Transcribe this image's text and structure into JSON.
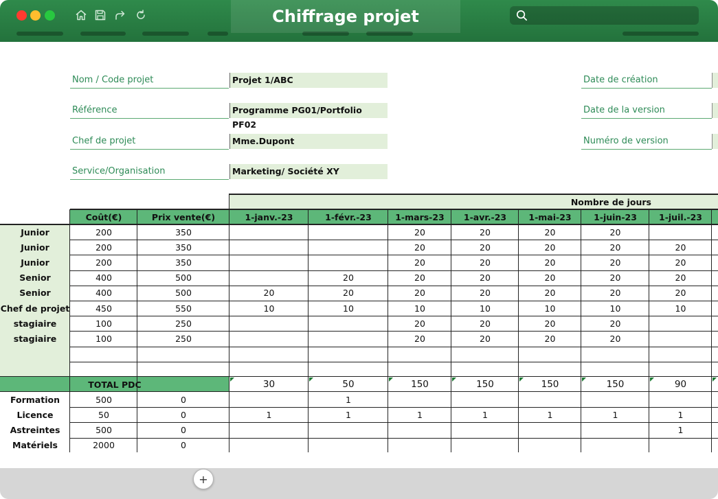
{
  "window": {
    "title": "Chiffrage projet"
  },
  "search": {
    "placeholder": ""
  },
  "project_info": {
    "left": [
      {
        "label": "Nom / Code projet",
        "value": "Projet 1/ABC"
      },
      {
        "label": "Référence",
        "value": "Programme PG01/Portfolio PF02"
      },
      {
        "label": "Chef de projet",
        "value": "Mme.Dupont"
      },
      {
        "label": "Service/Organisation",
        "value": "Marketing/ Société XY"
      }
    ],
    "right": [
      {
        "label": "Date de création",
        "value": ""
      },
      {
        "label": "Date de la version",
        "value": ""
      },
      {
        "label": "Numéro de version",
        "value": ""
      }
    ]
  },
  "table": {
    "group_header": "Nombre de jours",
    "headers": [
      "Coût(€)",
      "Prix vente(€)",
      "1-janv.-23",
      "1-févr.-23",
      "1-mars-23",
      "1-avr.-23",
      "1-mai-23",
      "1-juin-23",
      "1-juil.-23"
    ],
    "rows": [
      {
        "role": "Junior",
        "cost": "200",
        "price": "350",
        "days": [
          "",
          "",
          "20",
          "20",
          "20",
          "20",
          ""
        ]
      },
      {
        "role": "Junior",
        "cost": "200",
        "price": "350",
        "days": [
          "",
          "",
          "20",
          "20",
          "20",
          "20",
          "20"
        ]
      },
      {
        "role": "Junior",
        "cost": "200",
        "price": "350",
        "days": [
          "",
          "",
          "20",
          "20",
          "20",
          "20",
          "20"
        ]
      },
      {
        "role": "Senior",
        "cost": "400",
        "price": "500",
        "days": [
          "",
          "20",
          "20",
          "20",
          "20",
          "20",
          "20"
        ]
      },
      {
        "role": "Senior",
        "cost": "400",
        "price": "500",
        "days": [
          "20",
          "20",
          "20",
          "20",
          "20",
          "20",
          "20"
        ]
      },
      {
        "role": "Chef de projet",
        "cost": "450",
        "price": "550",
        "days": [
          "10",
          "10",
          "10",
          "10",
          "10",
          "10",
          "10"
        ]
      },
      {
        "role": "stagiaire",
        "cost": "100",
        "price": "250",
        "days": [
          "",
          "",
          "20",
          "20",
          "20",
          "20",
          ""
        ]
      },
      {
        "role": "stagiaire",
        "cost": "100",
        "price": "250",
        "days": [
          "",
          "",
          "20",
          "20",
          "20",
          "20",
          ""
        ]
      },
      {
        "role": "",
        "cost": "",
        "price": "",
        "days": [
          "",
          "",
          "",
          "",
          "",
          "",
          ""
        ]
      },
      {
        "role": "",
        "cost": "",
        "price": "",
        "days": [
          "",
          "",
          "",
          "",
          "",
          "",
          ""
        ]
      }
    ],
    "total": {
      "label": "TOTAL PDC",
      "values": [
        "30",
        "50",
        "150",
        "150",
        "150",
        "150",
        "90"
      ]
    },
    "extras": [
      {
        "label": "Formation",
        "cost": "500",
        "price": "0",
        "days": [
          "",
          "1",
          "",
          "",
          "",
          "",
          ""
        ]
      },
      {
        "label": "Licence",
        "cost": "50",
        "price": "0",
        "days": [
          "1",
          "1",
          "1",
          "1",
          "1",
          "1",
          "1"
        ]
      },
      {
        "label": "Astreintes",
        "cost": "500",
        "price": "0",
        "days": [
          "",
          "",
          "",
          "",
          "",
          "",
          "1"
        ]
      },
      {
        "label": "Matériels",
        "cost": "2000",
        "price": "0",
        "days": [
          "",
          "",
          "",
          "",
          "",
          "",
          ""
        ]
      }
    ]
  },
  "footer": {
    "add_sheet": "+"
  },
  "colors": {
    "titlebar": "#2f8a4b",
    "header_green": "#5db779",
    "input_green": "#e2efda",
    "role_bg": "#e2efda"
  }
}
